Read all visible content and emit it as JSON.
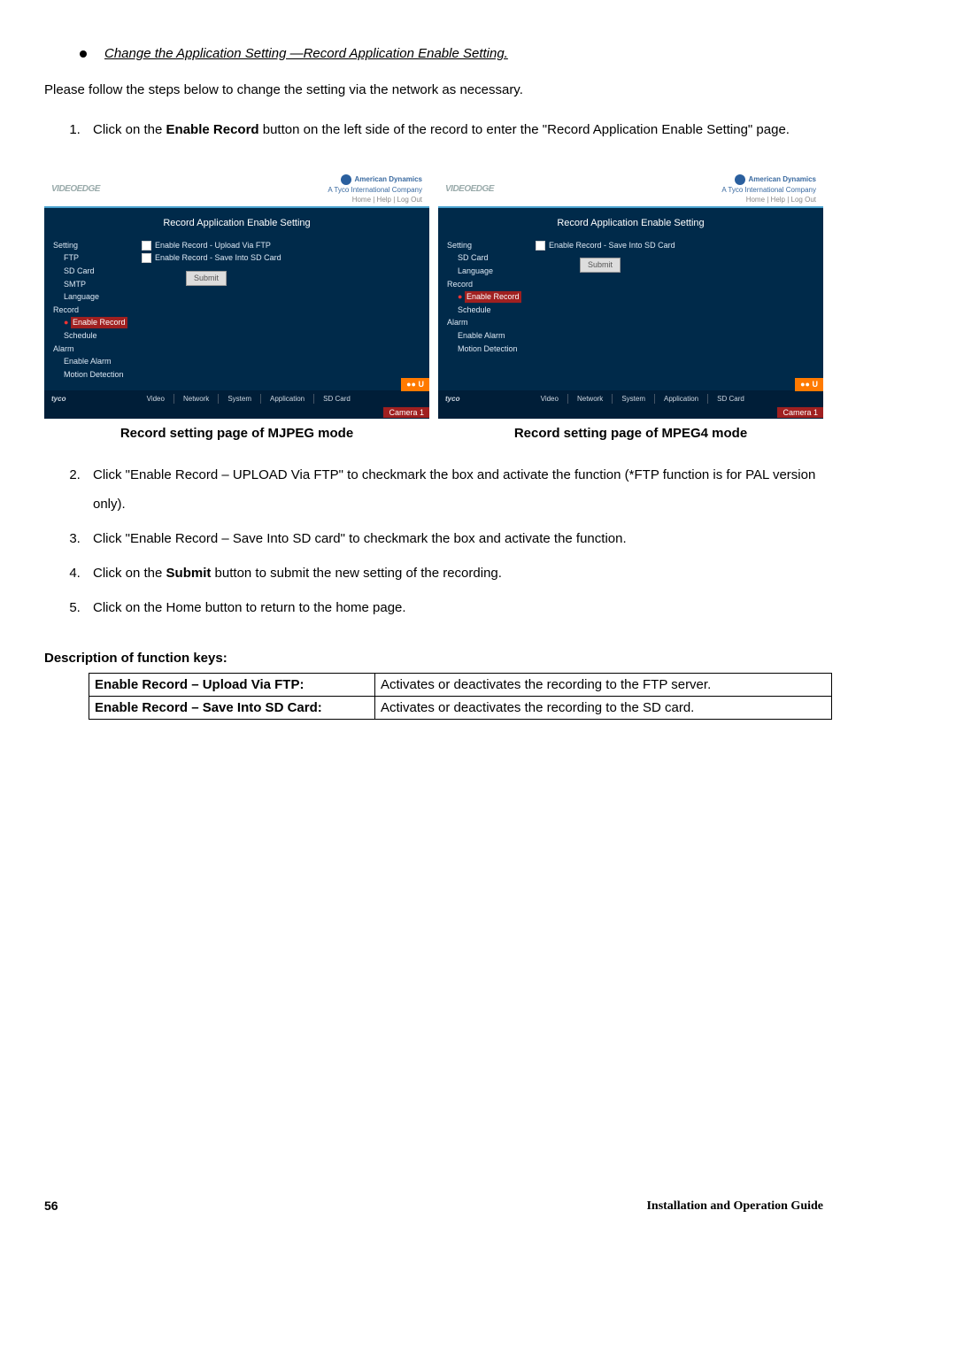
{
  "section_title": "Change the Application Setting —Record Application Enable Setting.",
  "intro": "Please follow the steps below to change the setting via the network as necessary.",
  "step1_pre": "Click on the ",
  "step1_bold": "Enable Record",
  "step1_post": " button on the left side of the record to enter the \"Record Application Enable Setting\" page.",
  "shot": {
    "brand": "VIDEOEDGE",
    "brand_right_label": "American Dynamics",
    "brand_right_sub": "A Tyco International Company",
    "toplinks": "Home   |   Help   |   Log Out",
    "panel_title": "Record Application Enable Setting",
    "sidebar_mjpeg": {
      "setting": "Setting",
      "ftp": "FTP",
      "sdcard": "SD Card",
      "smtp": "SMTP",
      "language": "Language",
      "record": "Record",
      "enable_record": "Enable Record",
      "schedule": "Schedule",
      "alarm": "Alarm",
      "enable_alarm": "Enable Alarm",
      "motion": "Motion Detection"
    },
    "sidebar_mpeg4": {
      "setting": "Setting",
      "sdcard": "SD Card",
      "language": "Language",
      "record": "Record",
      "enable_record": "Enable Record",
      "schedule": "Schedule",
      "alarm": "Alarm",
      "enable_alarm": "Enable Alarm",
      "motion": "Motion Detection"
    },
    "chk_upload": "Enable Record - Upload Via FTP",
    "chk_save": "Enable Record - Save Into SD Card",
    "submit": "Submit",
    "footer_brand": "tyco",
    "footer_links": [
      "Video",
      "Network",
      "System",
      "Application",
      "SD Card"
    ],
    "corner": "●● U",
    "camera": "Camera 1"
  },
  "caption_mjpeg": "Record setting page of MJPEG mode",
  "caption_mpeg4": "Record setting page of MPEG4 mode",
  "step2": "Click \"Enable Record – UPLOAD Via FTP\" to checkmark the box and activate the function (*FTP function is for PAL version only).",
  "step3": "Click \"Enable Record – Save Into SD card\" to checkmark the box and activate the function.",
  "step4_pre": "Click on the ",
  "step4_bold": "Submit",
  "step4_post": " button to submit the new setting of the recording.",
  "step5": "Click on the Home button to return to the home page.",
  "desc_heading": "Description of function keys:",
  "table": {
    "r1k": "Enable Record – Upload Via FTP:",
    "r1v": "Activates or deactivates the recording to the FTP server.",
    "r2k": "Enable Record – Save Into SD Card:",
    "r2v": "Activates or deactivates the recording to the SD card."
  },
  "page_number": "56",
  "guide_label": "Installation and Operation Guide"
}
